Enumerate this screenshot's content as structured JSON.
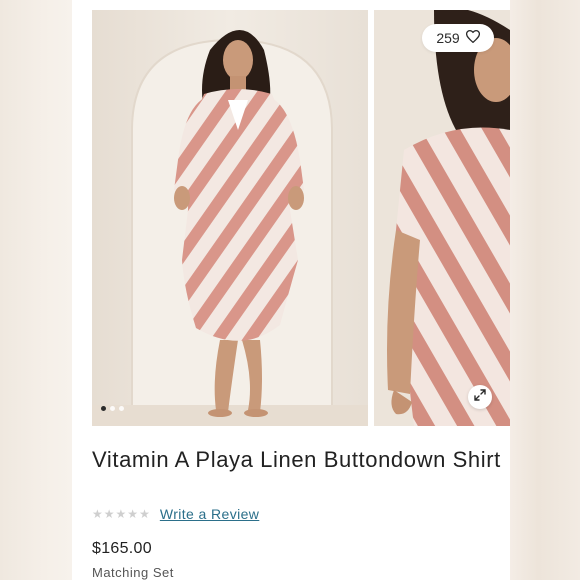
{
  "product": {
    "title": "Vitamin A Playa Linen Buttondown Shirt",
    "rating_stars": 0,
    "rating_max": 5,
    "review_link": "Write a Review",
    "price": "$165.00",
    "subtext": "Matching Set"
  },
  "gallery": {
    "likes": "259",
    "slides": 3,
    "active_slide": 1
  },
  "icons": {
    "like": "heart-icon",
    "expand": "expand-icon",
    "star": "star-icon"
  },
  "colors": {
    "print": "#d9968a",
    "link": "#2b6f8a",
    "star_empty": "#cfcfcf"
  }
}
